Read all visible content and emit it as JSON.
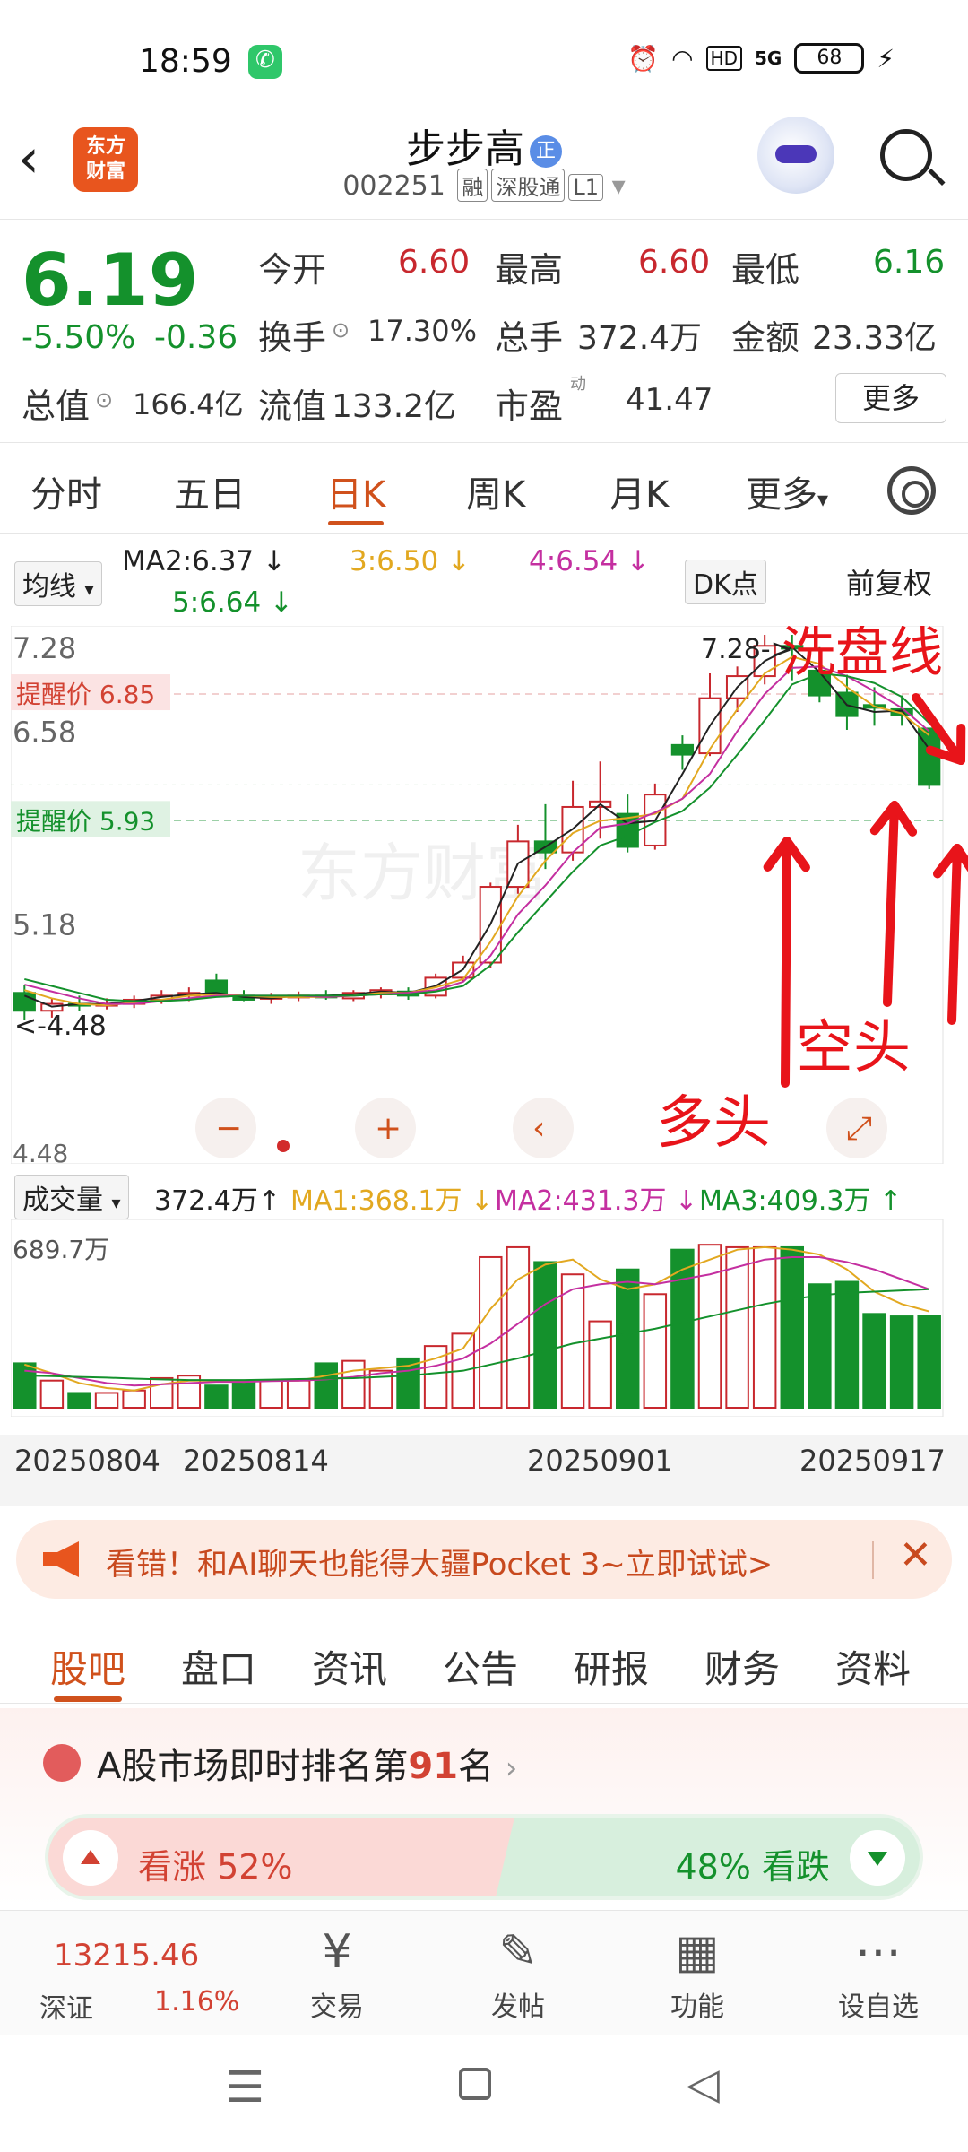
{
  "status_bar": {
    "time": "18:59",
    "network": "5G",
    "hd": "HD",
    "battery": "68"
  },
  "header": {
    "logo_text_line1": "东方",
    "logo_text_line2": "财富",
    "name": "步步高",
    "name_badge": "正",
    "code": "002251",
    "tags": [
      "融",
      "深股通",
      "L1"
    ]
  },
  "quote": {
    "price": "6.19",
    "change_pct": "-5.50%",
    "change": "-0.36",
    "open_label": "今开",
    "open": "6.60",
    "high_label": "最高",
    "high": "6.60",
    "low_label": "最低",
    "low": "6.16",
    "turnover_label": "换手",
    "turnover": "17.30%",
    "volume_label": "总手",
    "volume": "372.4万",
    "amount_label": "金额",
    "amount": "23.33亿",
    "mktcap_label": "总值",
    "mktcap": "166.4亿",
    "float_label": "流值",
    "float": "133.2亿",
    "pe_label": "市盈",
    "pe_sup": "动",
    "pe": "41.47",
    "more": "更多"
  },
  "period_tabs": [
    "分时",
    "五日",
    "日K",
    "周K",
    "月K",
    "更多"
  ],
  "period_active": 2,
  "ma_row": {
    "selector": "均线",
    "ma2": "MA2:6.37",
    "ma3": "3:6.50",
    "ma4": "4:6.54",
    "ma5": "5:6.64",
    "dk": "DK点",
    "fq": "前复权",
    "colors": {
      "ma2": "#222222",
      "ma3": "#e2a820",
      "ma4": "#c42fa0",
      "ma5": "#14912c"
    }
  },
  "kchart_labels": {
    "price_top": "7.28",
    "price_2": "6.58",
    "price_3": "5.18",
    "price_low": "4.48",
    "alert_high": "提醒价 6.85",
    "alert_low": "提醒价 5.93",
    "max_marker": "7.28->",
    "min_marker": "<-4.48",
    "watermark": "东方财富"
  },
  "annotations": {
    "wash": "洗盘线",
    "bear": "空头",
    "bull": "多头"
  },
  "chart_data": {
    "type": "candlestick",
    "ylim": [
      4.48,
      7.28
    ],
    "colors": {
      "up": "#c8282e",
      "down": "#14912c"
    },
    "candles": [
      {
        "o": 4.68,
        "h": 4.74,
        "l": 4.48,
        "c": 4.55
      },
      {
        "o": 4.55,
        "h": 4.64,
        "l": 4.5,
        "c": 4.6
      },
      {
        "o": 4.6,
        "h": 4.66,
        "l": 4.55,
        "c": 4.59
      },
      {
        "o": 4.59,
        "h": 4.64,
        "l": 4.56,
        "c": 4.6
      },
      {
        "o": 4.6,
        "h": 4.66,
        "l": 4.57,
        "c": 4.63
      },
      {
        "o": 4.63,
        "h": 4.7,
        "l": 4.6,
        "c": 4.66
      },
      {
        "o": 4.66,
        "h": 4.72,
        "l": 4.62,
        "c": 4.68
      },
      {
        "o": 4.77,
        "h": 4.82,
        "l": 4.65,
        "c": 4.67
      },
      {
        "o": 4.66,
        "h": 4.7,
        "l": 4.62,
        "c": 4.63
      },
      {
        "o": 4.64,
        "h": 4.68,
        "l": 4.6,
        "c": 4.65
      },
      {
        "o": 4.65,
        "h": 4.69,
        "l": 4.62,
        "c": 4.66
      },
      {
        "o": 4.66,
        "h": 4.7,
        "l": 4.63,
        "c": 4.65
      },
      {
        "o": 4.64,
        "h": 4.7,
        "l": 4.62,
        "c": 4.68
      },
      {
        "o": 4.67,
        "h": 4.72,
        "l": 4.64,
        "c": 4.7
      },
      {
        "o": 4.69,
        "h": 4.72,
        "l": 4.63,
        "c": 4.66
      },
      {
        "o": 4.66,
        "h": 4.82,
        "l": 4.64,
        "c": 4.79
      },
      {
        "o": 4.79,
        "h": 4.95,
        "l": 4.76,
        "c": 4.9
      },
      {
        "o": 4.9,
        "h": 5.48,
        "l": 4.86,
        "c": 5.45
      },
      {
        "o": 5.45,
        "h": 5.9,
        "l": 5.4,
        "c": 5.78
      },
      {
        "o": 5.78,
        "h": 6.05,
        "l": 5.58,
        "c": 5.7
      },
      {
        "o": 5.7,
        "h": 6.22,
        "l": 5.64,
        "c": 6.03
      },
      {
        "o": 6.03,
        "h": 6.36,
        "l": 5.8,
        "c": 6.07
      },
      {
        "o": 5.98,
        "h": 6.12,
        "l": 5.7,
        "c": 5.74
      },
      {
        "o": 5.75,
        "h": 6.2,
        "l": 5.72,
        "c": 6.12
      },
      {
        "o": 6.48,
        "h": 6.55,
        "l": 6.3,
        "c": 6.41
      },
      {
        "o": 6.42,
        "h": 7.0,
        "l": 6.4,
        "c": 6.82
      },
      {
        "o": 6.82,
        "h": 7.05,
        "l": 6.72,
        "c": 6.98
      },
      {
        "o": 6.98,
        "h": 7.28,
        "l": 6.92,
        "c": 7.2
      },
      {
        "o": 7.2,
        "h": 7.28,
        "l": 6.95,
        "c": 7.18
      },
      {
        "o": 7.02,
        "h": 7.19,
        "l": 6.79,
        "c": 6.84
      },
      {
        "o": 6.86,
        "h": 6.99,
        "l": 6.59,
        "c": 6.69
      },
      {
        "o": 6.77,
        "h": 6.9,
        "l": 6.62,
        "c": 6.75
      },
      {
        "o": 6.74,
        "h": 6.84,
        "l": 6.62,
        "c": 6.7
      },
      {
        "o": 6.6,
        "h": 6.6,
        "l": 6.16,
        "c": 6.19
      }
    ],
    "ma": [
      {
        "name": "MA2",
        "color": "#222222",
        "values": [
          4.66,
          4.58,
          4.6,
          4.6,
          4.62,
          4.65,
          4.67,
          4.68,
          4.65,
          4.64,
          4.66,
          4.66,
          4.67,
          4.69,
          4.68,
          4.73,
          4.85,
          5.18,
          5.62,
          5.74,
          5.87,
          6.05,
          5.91,
          5.93,
          6.27,
          6.62,
          6.9,
          7.09,
          7.19,
          7.01,
          6.77,
          6.72,
          6.73,
          6.45
        ]
      },
      {
        "name": "MA3",
        "color": "#e2a820",
        "values": [
          4.7,
          4.64,
          4.6,
          4.59,
          4.61,
          4.63,
          4.66,
          4.67,
          4.66,
          4.65,
          4.65,
          4.65,
          4.66,
          4.68,
          4.68,
          4.72,
          4.78,
          5.05,
          5.38,
          5.64,
          5.84,
          5.93,
          5.95,
          5.98,
          6.09,
          6.45,
          6.74,
          7.0,
          7.12,
          7.07,
          6.9,
          6.76,
          6.71,
          6.55
        ]
      },
      {
        "name": "MA4",
        "color": "#c42fa0",
        "values": [
          4.74,
          4.69,
          4.64,
          4.6,
          4.6,
          4.62,
          4.64,
          4.66,
          4.66,
          4.66,
          4.66,
          4.65,
          4.66,
          4.67,
          4.68,
          4.7,
          4.76,
          4.95,
          5.25,
          5.46,
          5.7,
          5.88,
          5.91,
          5.99,
          6.09,
          6.27,
          6.58,
          6.85,
          7.04,
          7.05,
          6.98,
          6.87,
          6.75,
          6.58
        ]
      },
      {
        "name": "MA5",
        "color": "#14912c",
        "values": [
          4.78,
          4.73,
          4.68,
          4.63,
          4.62,
          4.62,
          4.63,
          4.65,
          4.66,
          4.66,
          4.66,
          4.66,
          4.66,
          4.67,
          4.67,
          4.69,
          4.73,
          4.88,
          5.12,
          5.34,
          5.56,
          5.75,
          5.82,
          5.92,
          6.0,
          6.17,
          6.41,
          6.66,
          6.92,
          7.0,
          6.98,
          6.93,
          6.83,
          6.64
        ]
      }
    ],
    "volume": {
      "ylim": [
        0,
        689.7
      ],
      "values": [
        180,
        110,
        60,
        60,
        70,
        120,
        130,
        90,
        110,
        110,
        110,
        180,
        190,
        150,
        200,
        250,
        300,
        610,
        650,
        590,
        540,
        350,
        560,
        460,
        640,
        660,
        650,
        650,
        650,
        500,
        510,
        380,
        370,
        372.4
      ],
      "ma": [
        {
          "name": "MA1",
          "color": "#e2a820",
          "values": [
            175,
            140,
            100,
            80,
            70,
            95,
            110,
            110,
            105,
            110,
            110,
            130,
            150,
            160,
            170,
            200,
            240,
            400,
            520,
            580,
            600,
            520,
            480,
            500,
            560,
            600,
            640,
            650,
            640,
            620,
            560,
            470,
            420,
            390
          ]
        },
        {
          "name": "MA2",
          "color": "#c42fa0",
          "values": [
            150,
            140,
            120,
            100,
            90,
            95,
            100,
            105,
            105,
            108,
            110,
            115,
            125,
            140,
            150,
            170,
            200,
            260,
            340,
            420,
            480,
            500,
            510,
            500,
            520,
            540,
            570,
            600,
            610,
            610,
            590,
            560,
            520,
            480
          ]
        },
        {
          "name": "MA3",
          "color": "#14912c",
          "values": [
            130,
            128,
            125,
            122,
            118,
            115,
            112,
            112,
            112,
            114,
            116,
            118,
            120,
            125,
            130,
            140,
            150,
            175,
            200,
            230,
            260,
            280,
            300,
            320,
            345,
            370,
            395,
            420,
            440,
            455,
            465,
            470,
            475,
            480
          ]
        }
      ]
    },
    "x_tick_labels": [
      "20250804",
      "20250814",
      "20250901",
      "20250917"
    ]
  },
  "volume_row": {
    "selector": "成交量",
    "vol": "372.4万",
    "ma1": "MA1:368.1万",
    "ma2": "MA2:431.3万",
    "ma3": "MA3:409.3万",
    "vol_top": "689.7万"
  },
  "banner": {
    "text": "看错！和AI聊天也能得大疆Pocket 3~立即试试>"
  },
  "content_tabs": [
    "股吧",
    "盘口",
    "资讯",
    "公告",
    "研报",
    "财务",
    "资料"
  ],
  "content_active": 0,
  "ranking": {
    "title_prefix": "A股市场即时排名第",
    "rank": "91",
    "title_suffix": "名",
    "up_label": "看涨 52%",
    "down_label": "48% 看跌"
  },
  "bottom_nav": {
    "index_value": "13215.46",
    "index_name": "深证",
    "index_pct": "1.16%",
    "items": [
      "交易",
      "发帖",
      "功能",
      "设自选"
    ]
  }
}
